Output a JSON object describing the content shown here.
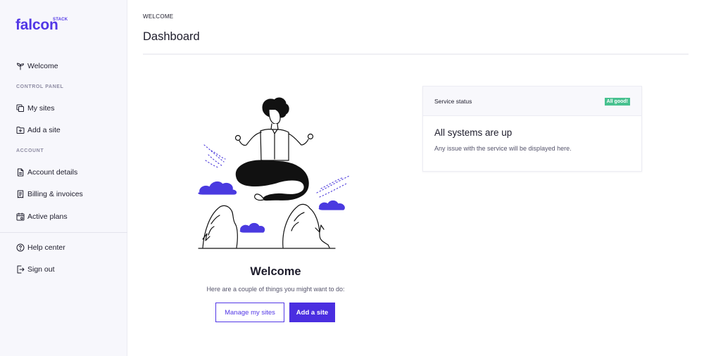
{
  "brand": {
    "name": "falcon",
    "tag": "STACK",
    "accent": "#5237e6"
  },
  "sidebar": {
    "items": [
      {
        "label": "Welcome",
        "icon": "sprout-icon"
      },
      {
        "label": "My sites",
        "icon": "copy-icon"
      },
      {
        "label": "Add a site",
        "icon": "folder-plus-icon"
      },
      {
        "label": "Account details",
        "icon": "document-icon"
      },
      {
        "label": "Billing & invoices",
        "icon": "receipt-icon"
      },
      {
        "label": "Active plans",
        "icon": "calendar-icon"
      },
      {
        "label": "Help center",
        "icon": "help-circle-icon"
      },
      {
        "label": "Sign out",
        "icon": "sign-out-icon"
      }
    ],
    "sections": {
      "control_panel": "CONTROL PANEL",
      "account": "ACCOUNT"
    }
  },
  "header": {
    "breadcrumb": "WELCOME",
    "title": "Dashboard"
  },
  "welcome": {
    "title": "Welcome",
    "subtitle": "Here are a couple of things you might want to do:",
    "manage_label": "Manage my sites",
    "add_label": "Add a site"
  },
  "status_card": {
    "header": "Service status",
    "badge": "All good!",
    "badge_color": "#47c18f",
    "title": "All systems are up",
    "text": "Any issue with the service will be displayed here."
  }
}
